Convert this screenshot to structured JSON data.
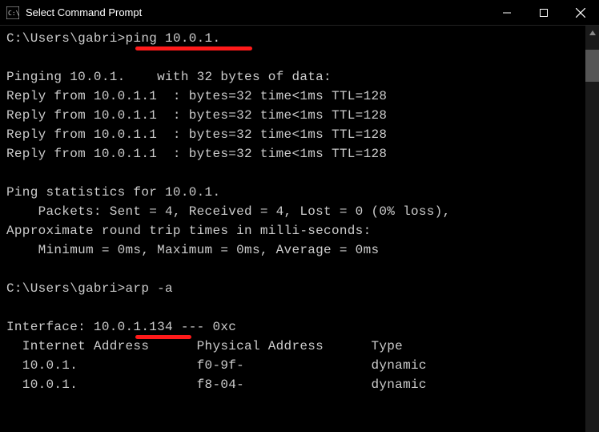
{
  "titlebar": {
    "title": "Select Command Prompt"
  },
  "terminal": {
    "prompt1": "C:\\Users\\gabri>",
    "cmd1": "ping 10.0.1.",
    "blank0": "",
    "pingHeader": "Pinging 10.0.1.    with 32 bytes of data:",
    "reply1": "Reply from 10.0.1.1  : bytes=32 time<1ms TTL=128",
    "reply2": "Reply from 10.0.1.1  : bytes=32 time<1ms TTL=128",
    "reply3": "Reply from 10.0.1.1  : bytes=32 time<1ms TTL=128",
    "reply4": "Reply from 10.0.1.1  : bytes=32 time<1ms TTL=128",
    "blank1": "",
    "statsHeader": "Ping statistics for 10.0.1.",
    "packets": "    Packets: Sent = 4, Received = 4, Lost = 0 (0% loss),",
    "rttHeader": "Approximate round trip times in milli-seconds:",
    "rtt": "    Minimum = 0ms, Maximum = 0ms, Average = 0ms",
    "blank2": "",
    "prompt2": "C:\\Users\\gabri>",
    "cmd2": "arp -a",
    "blank3": "",
    "arpInterface": "Interface: 10.0.1.134 --- 0xc",
    "arpHeader": "  Internet Address      Physical Address      Type",
    "arpRow1": "  10.0.1.               f0-9f-                dynamic",
    "arpRow2": "  10.0.1.               f8-04-                dynamic"
  }
}
